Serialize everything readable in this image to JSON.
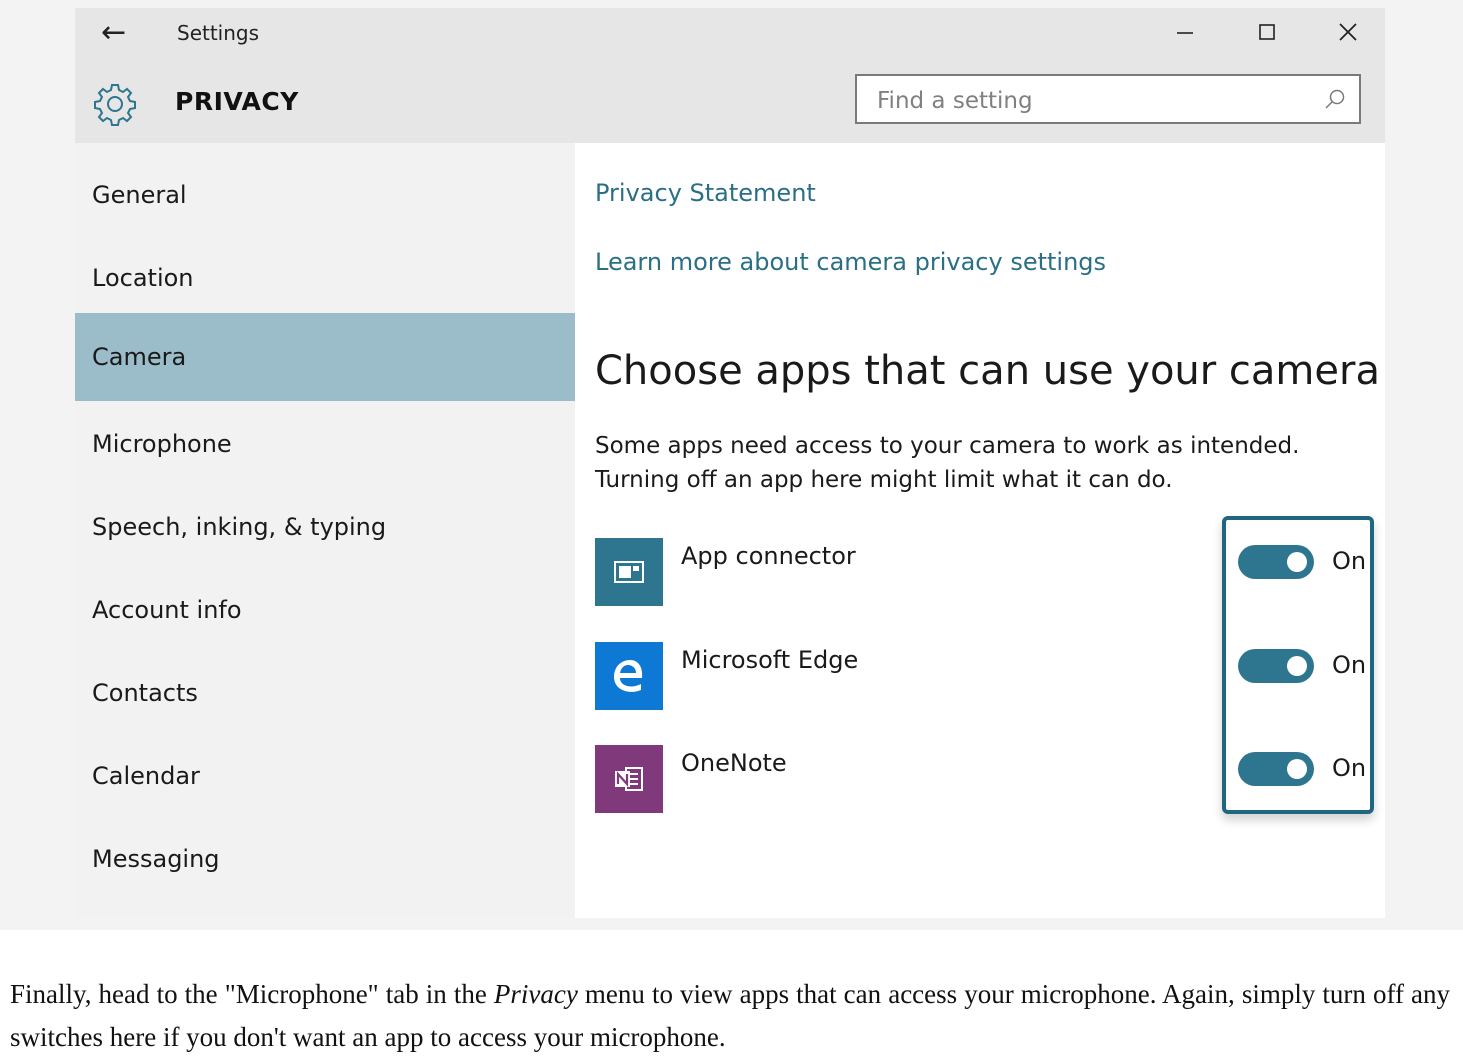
{
  "window": {
    "app_name": "Settings",
    "back_icon": "arrow-left-icon",
    "minimize_icon": "minimize-icon",
    "maximize_icon": "maximize-icon",
    "close_icon": "close-icon"
  },
  "header": {
    "icon": "gear-icon",
    "title": "PRIVACY",
    "search": {
      "placeholder": "Find a setting",
      "value": "",
      "icon": "search-icon"
    }
  },
  "sidebar": {
    "items": [
      {
        "label": "General"
      },
      {
        "label": "Location"
      },
      {
        "label": "Camera",
        "selected": true
      },
      {
        "label": "Microphone"
      },
      {
        "label": "Speech, inking, & typing"
      },
      {
        "label": "Account info"
      },
      {
        "label": "Contacts"
      },
      {
        "label": "Calendar"
      },
      {
        "label": "Messaging"
      }
    ],
    "selected_color": "#9bbcc9"
  },
  "content": {
    "privacy_link": "Privacy Statement",
    "learn_more_link": "Learn more about camera privacy settings",
    "heading": "Choose apps that can use your camera",
    "description_line1": "Some apps need access to your camera to work as intended.",
    "description_line2": "Turning off an app here might limit what it can do.",
    "link_color": "#2a6f86",
    "apps": [
      {
        "name": "App connector",
        "icon": "app-connector-icon",
        "icon_color": "#2e7590",
        "toggle": "On"
      },
      {
        "name": "Microsoft Edge",
        "icon": "microsoft-edge-icon",
        "icon_color": "#0e78d5",
        "toggle": "On"
      },
      {
        "name": "OneNote",
        "icon": "onenote-icon",
        "icon_color": "#80397b",
        "toggle": "On"
      }
    ],
    "toggle_color": "#2e7590"
  },
  "caption": {
    "before": "Finally, head to the \"Microphone\" tab in the ",
    "emphasis": "Privacy",
    "after": " menu to view apps that can access your microphone. Again, simply turn off any switches here if you don't want an app to access your microphone."
  }
}
